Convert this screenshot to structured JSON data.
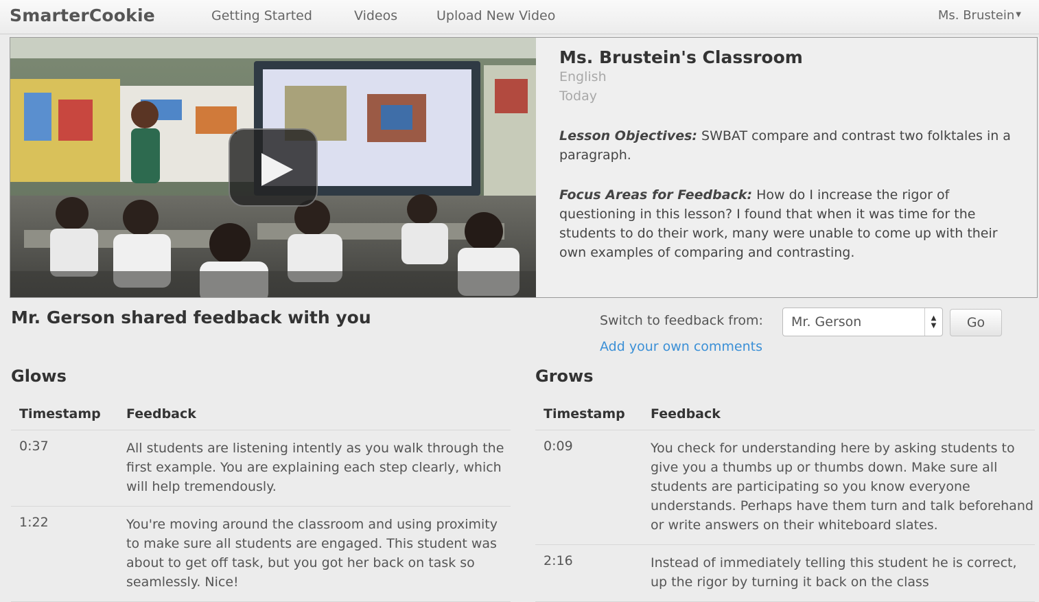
{
  "nav": {
    "brand": "SmarterCookie",
    "items": [
      "Getting Started",
      "Videos",
      "Upload New Video"
    ],
    "user": "Ms. Brustein"
  },
  "lesson": {
    "title": "Ms. Brustein's Classroom",
    "subject": "English",
    "date": "Today",
    "objectives_label": "Lesson Objectives:",
    "objectives_text": "SWBAT compare and contrast two folktales in a paragraph.",
    "focus_label": "Focus Areas for Feedback:",
    "focus_text": "How do I increase the rigor of questioning in this lesson? I found that when it was time for the students to do their work, many were unable to come up with their own examples of comparing and contrasting."
  },
  "feedback": {
    "shared_heading": "Mr. Gerson shared feedback with you",
    "switch_label": "Switch to feedback from:",
    "selected_reviewer": "Mr. Gerson",
    "go_label": "Go",
    "add_comments_link": "Add your own comments"
  },
  "glows": {
    "title": "Glows",
    "headers": [
      "Timestamp",
      "Feedback"
    ],
    "rows": [
      {
        "timestamp": "0:37",
        "feedback": "All students are listening intently as you walk through the first example. You are explaining each step clearly, which will help tremendously."
      },
      {
        "timestamp": "1:22",
        "feedback": "You're moving around the classroom and using proximity to make sure all students are engaged. This student was about to get off task, but you got her back on task so seamlessly. Nice!"
      }
    ]
  },
  "grows": {
    "title": "Grows",
    "headers": [
      "Timestamp",
      "Feedback"
    ],
    "rows": [
      {
        "timestamp": "0:09",
        "feedback": "You check for understanding here by asking students to give you a thumbs up or thumbs down. Make sure all students are participating so you know everyone understands. Perhaps have them turn and talk beforehand or write answers on their whiteboard slates."
      },
      {
        "timestamp": "2:16",
        "feedback": "Instead of immediately telling this student he is correct, up the rigor by turning it back on the class"
      }
    ]
  },
  "icons": {
    "play": "play-icon",
    "user_caret": "caret-down-icon",
    "select_arrows": "select-arrows-icon"
  },
  "colors": {
    "link": "#3a8fd6",
    "player_button": "#232323"
  }
}
